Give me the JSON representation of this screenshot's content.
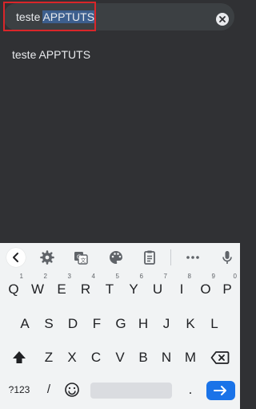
{
  "search": {
    "prefix": "teste ",
    "selected": "APPTUTS",
    "clear_icon": "close-circle-icon"
  },
  "suggestions": [
    {
      "text": "teste APPTUTS"
    }
  ],
  "keyboard": {
    "toolbar_icons": [
      "chevron-left-icon",
      "gear-icon",
      "translate-icon",
      "palette-icon",
      "clipboard-icon",
      "more-horizontal-icon",
      "microphone-icon"
    ],
    "row1": [
      {
        "label": "Q",
        "hint": "1"
      },
      {
        "label": "W",
        "hint": "2"
      },
      {
        "label": "E",
        "hint": "3"
      },
      {
        "label": "R",
        "hint": "4"
      },
      {
        "label": "T",
        "hint": "5"
      },
      {
        "label": "Y",
        "hint": "6"
      },
      {
        "label": "U",
        "hint": "7"
      },
      {
        "label": "I",
        "hint": "8"
      },
      {
        "label": "O",
        "hint": "9"
      },
      {
        "label": "P",
        "hint": "0"
      }
    ],
    "row2": [
      "A",
      "S",
      "D",
      "F",
      "G",
      "H",
      "J",
      "K",
      "L"
    ],
    "row3": [
      "Z",
      "X",
      "C",
      "V",
      "B",
      "N",
      "M"
    ],
    "symbols_label": "?123",
    "slash_label": "/",
    "period_label": ".",
    "shift_icon": "shift-icon",
    "backspace_icon": "backspace-icon",
    "emoji_icon": "emoji-icon",
    "enter_icon": "arrow-right-icon",
    "accent_color": "#1a73e8"
  }
}
